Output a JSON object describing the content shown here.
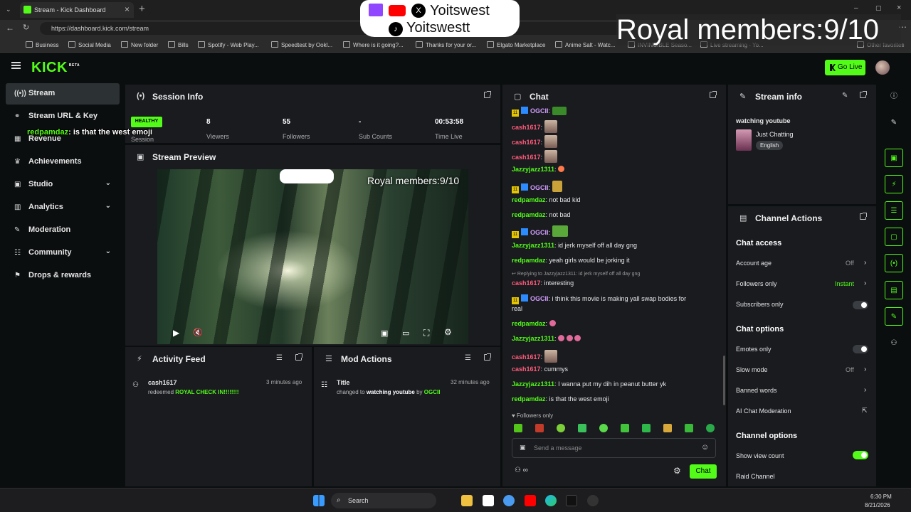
{
  "browser": {
    "tab_title": "Stream - Kick Dashboard",
    "url": "https://dashboard.kick.com/stream",
    "bookmarks": [
      "Business",
      "Social Media",
      "New folder",
      "Bills",
      "Spotify - Web Play...",
      "Speedtest by Ookl...",
      "Where is it going?...",
      "Thanks for your or...",
      "Elgato Marketplace",
      "Anime Salt - Watc...",
      "INVINCIBLE Seaso...",
      "Live streaming - Yo...",
      "Other favorites"
    ]
  },
  "overlay": {
    "handle_top": "Yoitswest",
    "handle_bottom": "Yoitswestt",
    "royal_members": "Royal members:9/10",
    "chat_popup_user": "redpamdaz",
    "chat_popup_text": "is that the west emoji"
  },
  "header": {
    "logo": "KICK",
    "logo_beta": "BETA",
    "go_live": "Go Live"
  },
  "sidebar": {
    "items": [
      {
        "label": "Stream",
        "icon": "broadcast-icon"
      },
      {
        "label": "Stream URL & Key",
        "icon": "link-icon"
      },
      {
        "label": "Revenue",
        "icon": "revenue-icon"
      },
      {
        "label": "Achievements",
        "icon": "trophy-icon"
      },
      {
        "label": "Studio",
        "icon": "studio-icon"
      },
      {
        "label": "Analytics",
        "icon": "analytics-icon"
      },
      {
        "label": "Moderation",
        "icon": "wrench-icon"
      },
      {
        "label": "Community",
        "icon": "community-icon"
      },
      {
        "label": "Drops & rewards",
        "icon": "gift-icon"
      }
    ]
  },
  "session": {
    "title": "Session Info",
    "status": "HEALTHY",
    "status_label": "Session",
    "viewers": "8",
    "viewers_label": "Viewers",
    "followers": "55",
    "followers_label": "Followers",
    "subs": "-",
    "subs_label": "Sub Counts",
    "time": "00:53:58",
    "time_label": "Time Live"
  },
  "preview": {
    "title": "Stream Preview",
    "royal_members": "Royal members:9/10"
  },
  "activity": {
    "title": "Activity Feed",
    "items": [
      {
        "user": "cash1617",
        "text": "redeemed",
        "reward": "ROYAL CHECK IN!!!!!!!!",
        "time": "3 minutes ago"
      }
    ]
  },
  "mod_actions": {
    "title": "Mod Actions",
    "items": [
      {
        "label": "Title",
        "text_prefix": "changed to",
        "value": "watching youtube",
        "by": "by",
        "mod": "OGCII",
        "time": "32 minutes ago"
      }
    ]
  },
  "chat": {
    "title": "Chat",
    "followers_only": "Followers only",
    "input_placeholder": "Send a message",
    "send": "Chat",
    "infinity": "∞",
    "messages": [
      {
        "user": "OGCII",
        "text": ""
      },
      {
        "user": "cash1617",
        "text": ""
      },
      {
        "user": "cash1617",
        "text": ""
      },
      {
        "user": "cash1617",
        "text": ""
      },
      {
        "user": "Jazzyjazz1311",
        "text": ""
      },
      {
        "user": "OGCII",
        "text": ""
      },
      {
        "user": "redpamdaz",
        "text": "not bad kid"
      },
      {
        "user": "redpamdaz",
        "text": "not bad"
      },
      {
        "user": "OGCII",
        "text": ""
      },
      {
        "user": "Jazzyjazz1311",
        "text": "id jerk myself off all day gng"
      },
      {
        "user": "redpamdaz",
        "text": "yeah girls would be jorking it"
      },
      {
        "reply": "Replying to Jazzyjazz1311: id jerk myself off all day gng"
      },
      {
        "user": "cash1617",
        "text": "interesting"
      },
      {
        "user": "OGCII",
        "text": "i think this movie is making yall swap bodies for",
        "text2": "real"
      },
      {
        "user": "redpamdaz",
        "text": ""
      },
      {
        "user": "Jazzyjazz1311",
        "text": ""
      },
      {
        "user": "cash1617",
        "text": ""
      },
      {
        "user": "cash1617",
        "text": "cummys"
      },
      {
        "user": "Jazzyjazz1311",
        "text": "I wanna put my dih in peanut butter yk"
      },
      {
        "user": "redpamdaz",
        "text": "is that the west emoji"
      }
    ]
  },
  "stream_info": {
    "title": "Stream info",
    "stream_title": "watching youtube",
    "category": "Just Chatting",
    "language": "English"
  },
  "channel_actions": {
    "title": "Channel Actions",
    "chat_access": "Chat access",
    "account_age": "Account age",
    "account_age_val": "Off",
    "followers_only": "Followers only",
    "followers_only_val": "Instant",
    "subscribers_only": "Subscribers only",
    "chat_options": "Chat options",
    "emotes_only": "Emotes only",
    "slow_mode": "Slow mode",
    "slow_mode_val": "Off",
    "banned_words": "Banned words",
    "ai_mod": "AI Chat Moderation",
    "channel_options": "Channel options",
    "show_view_count": "Show view count",
    "raid_channel": "Raid Channel"
  },
  "taskbar": {
    "search": "Search",
    "time": "6:30 PM",
    "date": "8/21/2026"
  },
  "colors": {
    "accent": "#53fc18",
    "panel": "#191b1f",
    "bg": "#0b0e0f"
  }
}
